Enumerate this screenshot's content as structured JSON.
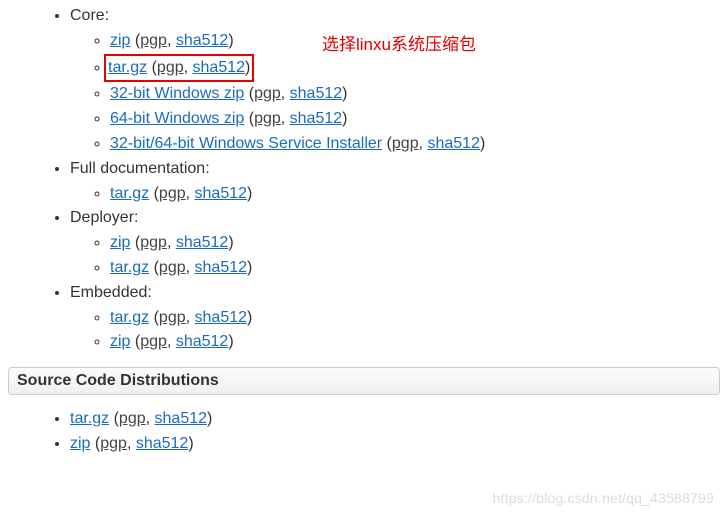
{
  "annotation": "选择linxu系统压缩包",
  "labels": {
    "core": "Core:",
    "fulldoc": "Full documentation:",
    "deployer": "Deployer:",
    "embedded": "Embedded:"
  },
  "core": {
    "items": [
      {
        "main": "zip",
        "pgp": "pgp",
        "sha": "sha512"
      },
      {
        "main": "tar.gz",
        "pgp": "pgp",
        "sha": "sha512"
      },
      {
        "main": "32-bit Windows zip",
        "pgp": "pgp",
        "sha": "sha512"
      },
      {
        "main": "64-bit Windows zip",
        "pgp": "pgp",
        "sha": "sha512"
      },
      {
        "main": "32-bit/64-bit Windows Service Installer",
        "pgp": "pgp",
        "sha": "sha512"
      }
    ]
  },
  "fulldoc": {
    "items": [
      {
        "main": "tar.gz",
        "pgp": "pgp",
        "sha": "sha512"
      }
    ]
  },
  "deployer": {
    "items": [
      {
        "main": "zip",
        "pgp": "pgp",
        "sha": "sha512"
      },
      {
        "main": "tar.gz",
        "pgp": "pgp",
        "sha": "sha512"
      }
    ]
  },
  "embedded": {
    "items": [
      {
        "main": "tar.gz",
        "pgp": "pgp",
        "sha": "sha512"
      },
      {
        "main": "zip",
        "pgp": "pgp",
        "sha": "sha512"
      }
    ]
  },
  "source_header": "Source Code Distributions",
  "source": {
    "items": [
      {
        "main": "tar.gz",
        "pgp": "pgp",
        "sha": "sha512"
      },
      {
        "main": "zip",
        "pgp": "pgp",
        "sha": "sha512"
      }
    ]
  },
  "watermark": "https://blog.csdn.net/qq_43588799"
}
